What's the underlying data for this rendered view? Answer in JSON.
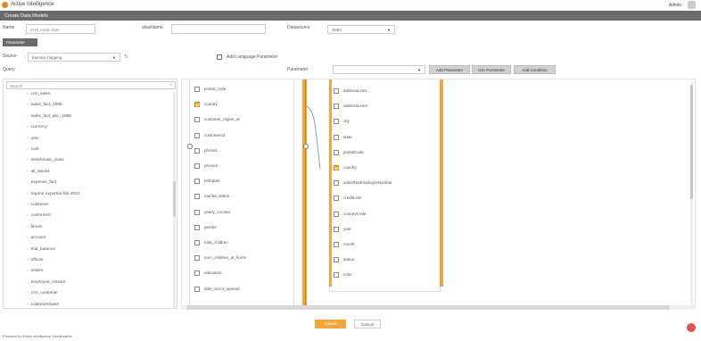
{
  "app": {
    "title": "Active Intelligence",
    "user": "Admin"
  },
  "dialog": {
    "title": "Create Data Models"
  },
  "form": {
    "name_label": "Name",
    "name_value": "Chill_Hindi Alias",
    "alias_label": "aliasName",
    "alias_value": "",
    "datasource_label": "Datasource",
    "datasource_value": "JDBC",
    "tab_label": "Parameter",
    "source_label": "Source",
    "source_value": "training mapping",
    "add_language_label": "Add Language Parameter",
    "query_label": "Query",
    "parameter_label": "Parameter",
    "parameter_value": ""
  },
  "buttons": {
    "add_parameter": "Add Parameter",
    "use_parameter": "Use Parameter",
    "add_condition": "Add Condition",
    "submit": "Submit",
    "cancel": "Cancel"
  },
  "query": {
    "search_placeholder": "Search",
    "items": [
      "crm_sales",
      "sales_fact_1998",
      "sales_fact_dec_1998",
      "currency",
      "user",
      "cust",
      "warehouse_class",
      "all_stocks",
      "expense_fact",
      "trapme exported feb 2021",
      "customer",
      "customers",
      "bloom",
      "account",
      "trial_balance",
      "offices",
      "orders",
      "employee_closure",
      "crm_customer",
      "customerdates"
    ]
  },
  "left_table": {
    "fields": [
      {
        "name": "postal_code",
        "checked": false
      },
      {
        "name": "country",
        "checked": true
      },
      {
        "name": "customer_region_id",
        "checked": false
      },
      {
        "name": "customercd",
        "checked": false
      },
      {
        "name": "phone1",
        "checked": false
      },
      {
        "name": "phone2",
        "checked": false
      },
      {
        "name": "birthdate",
        "checked": false
      },
      {
        "name": "marital_status",
        "checked": false
      },
      {
        "name": "yearly_income",
        "checked": false
      },
      {
        "name": "gender",
        "checked": false
      },
      {
        "name": "total_children",
        "checked": false
      },
      {
        "name": "num_children_at_home",
        "checked": false
      },
      {
        "name": "education",
        "checked": false
      },
      {
        "name": "date_accnt_opened",
        "checked": false
      }
    ]
  },
  "right_table": {
    "fields": [
      {
        "name": "addressLine1",
        "checked": false
      },
      {
        "name": "addressLine2",
        "checked": false
      },
      {
        "name": "city",
        "checked": false
      },
      {
        "name": "state",
        "checked": false
      },
      {
        "name": "postalCode",
        "checked": false
      },
      {
        "name": "country",
        "checked": true
      },
      {
        "name": "salesRepEmployeeNumber",
        "checked": false
      },
      {
        "name": "creditLimit",
        "checked": false
      },
      {
        "name": "countryCode",
        "checked": false
      },
      {
        "name": "year",
        "checked": false
      },
      {
        "name": "month",
        "checked": false
      },
      {
        "name": "status",
        "checked": false
      },
      {
        "name": "color",
        "checked": false
      }
    ]
  },
  "footer": {
    "text": "Powered by Active Intelligence Visualization"
  },
  "colors": {
    "accent": "#f2a73a",
    "header": "#6b6b6b"
  }
}
